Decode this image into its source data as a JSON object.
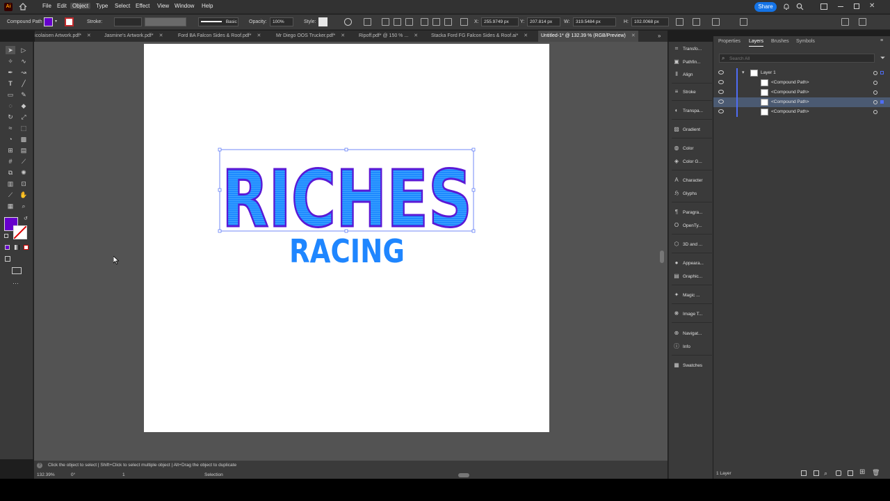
{
  "menubar": {
    "app_logo": "Ai",
    "items": [
      "File",
      "Edit",
      "Object",
      "Type",
      "Select",
      "Effect",
      "View",
      "Window",
      "Help"
    ],
    "active_item": "Object",
    "share_label": "Share"
  },
  "controlbar": {
    "selection_type": "Compound Path",
    "stroke_label": "Stroke:",
    "brush_label": "Basic",
    "opacity_label": "Opacity:",
    "opacity_value": "100%",
    "style_label": "Style:",
    "x_label": "X:",
    "x_value": "255.9749 px",
    "y_label": "Y:",
    "y_value": "207.814 px",
    "w_label": "W:",
    "w_value": "319.5484 px",
    "h_label": "H:",
    "h_value": "102.0068 px",
    "fill_color": "#6600cc"
  },
  "tabs": [
    {
      "label": "icolaisen Artwork.pdf*"
    },
    {
      "label": "Jasmine's Artwork.pdf*"
    },
    {
      "label": "Ford BA Falcon Sides & Roof.pdf*"
    },
    {
      "label": "Mr Diego OOS Trucker.pdf*"
    },
    {
      "label": "Ripoff.pdf* @ 150 % ..."
    },
    {
      "label": "Stacka Ford FG Falcon Sides & Roof.ai*"
    },
    {
      "label": "Untitled-1* @ 132.39 % (RGB/Preview)"
    }
  ],
  "artwork": {
    "line1": "RICHES",
    "line2": "RACING",
    "fill_color": "#1f86ff",
    "stroke_color": "#5a18d6"
  },
  "dock": [
    {
      "label": "Transfo...",
      "icon": "transform-icon"
    },
    {
      "label": "Pathfin...",
      "icon": "pathfinder-icon"
    },
    {
      "label": "Align",
      "icon": "align-icon"
    },
    {
      "label": "Stroke",
      "icon": "stroke-icon"
    },
    {
      "label": "Transpa...",
      "icon": "transparency-icon"
    },
    {
      "label": "Gradient",
      "icon": "gradient-icon"
    },
    {
      "label": "Color",
      "icon": "color-icon"
    },
    {
      "label": "Color G...",
      "icon": "color-guide-icon"
    },
    {
      "label": "Character",
      "icon": "character-icon"
    },
    {
      "label": "Glyphs",
      "icon": "glyphs-icon"
    },
    {
      "label": "Paragra...",
      "icon": "paragraph-icon"
    },
    {
      "label": "OpenTy...",
      "icon": "opentype-icon"
    },
    {
      "label": "3D and ...",
      "icon": "3d-icon"
    },
    {
      "label": "Appeara...",
      "icon": "appearance-icon"
    },
    {
      "label": "Graphic...",
      "icon": "graphic-styles-icon"
    },
    {
      "label": "Magic ...",
      "icon": "magic-icon"
    },
    {
      "label": "Image T...",
      "icon": "image-trace-icon"
    },
    {
      "label": "Navigat...",
      "icon": "navigator-icon"
    },
    {
      "label": "Info",
      "icon": "info-icon"
    },
    {
      "label": "Swatches",
      "icon": "swatches-icon"
    }
  ],
  "layers_panel": {
    "tabs": [
      "Properties",
      "Layers",
      "Brushes",
      "Symbols"
    ],
    "active_tab": "Layers",
    "search_placeholder": "Search All",
    "layer_name": "Layer 1",
    "items": [
      "<Compound Path>",
      "<Compound Path>",
      "<Compound Path>",
      "<Compound Path>"
    ],
    "selected_index": 2,
    "footer": "1 Layer"
  },
  "status": {
    "hint": "Click the object to select  |  Shift+Click to select multiple object  |  Alt+Drag the object to duplicate",
    "zoom": "132.39%",
    "rotation": "0°",
    "artboard": "1",
    "tool": "Selection"
  }
}
